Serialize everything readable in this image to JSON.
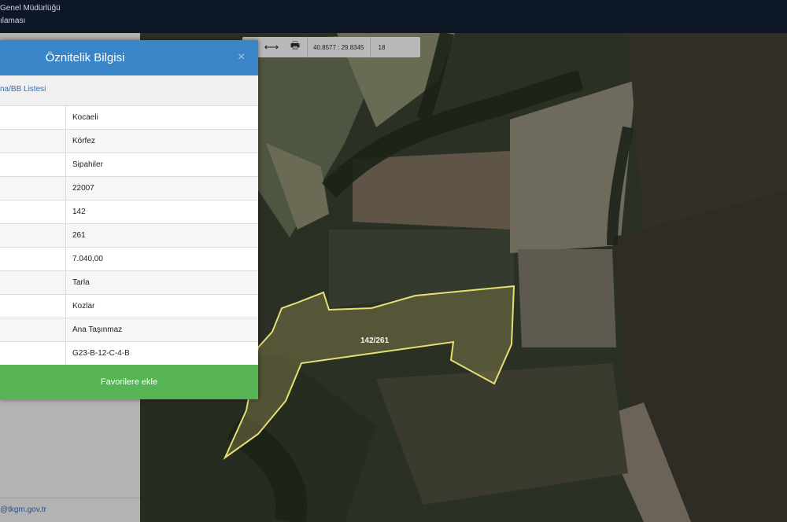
{
  "header": {
    "line1": "Genel Müdürlüğü",
    "line2": "ılaması"
  },
  "left_panel": {
    "footer_text": "@tkgm.gov.tr"
  },
  "map": {
    "parcel_label": "142/261",
    "toolbar": {
      "star_icon": "★",
      "measure_icon": "⟷",
      "print_icon": "🖶",
      "coordinates": "40.8577 : 29.8345",
      "zoom_level": "18"
    },
    "colors": {
      "parcel_outline": "#e6df73",
      "toolbar_bg": "#b9b9b9"
    }
  },
  "dialog": {
    "title": "Öznitelik Bilgisi",
    "close_symbol": "×",
    "link": "na/BB Listesi",
    "rows": [
      {
        "value": "Kocaeli"
      },
      {
        "value": "Körfez"
      },
      {
        "value": "Sipahiler"
      },
      {
        "value": "22007"
      },
      {
        "value": "142"
      },
      {
        "value": "261"
      },
      {
        "value": "7.040,00"
      },
      {
        "value": "Tarla"
      },
      {
        "value": "Kozlar"
      },
      {
        "value": "Ana Taşınmaz"
      },
      {
        "value": "G23-B-12-C-4-B"
      }
    ],
    "favorite_button": "Favorilere ekle",
    "colors": {
      "header": "#3a85c7",
      "button": "#56b454"
    }
  }
}
